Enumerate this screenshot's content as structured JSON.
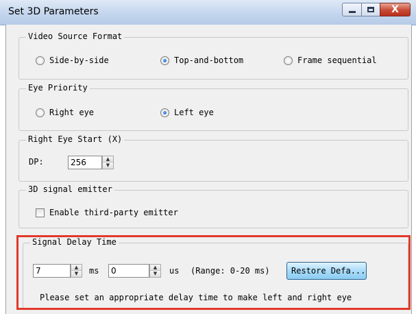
{
  "window": {
    "title": "Set 3D Parameters",
    "close_glyph": "X"
  },
  "video_source": {
    "title": "Video Source Format",
    "options": [
      {
        "label": "Side-by-side",
        "selected": false
      },
      {
        "label": "Top-and-bottom",
        "selected": true
      },
      {
        "label": "Frame sequential",
        "selected": false
      }
    ]
  },
  "eye_priority": {
    "title": "Eye Priority",
    "options": [
      {
        "label": "Right eye",
        "selected": false
      },
      {
        "label": "Left eye",
        "selected": true
      }
    ]
  },
  "right_eye_start": {
    "title": "Right Eye Start (X)",
    "dp_label": "DP:",
    "dp_value": "256"
  },
  "emitter": {
    "title": "3D signal emitter",
    "checkbox_label": "Enable third-party emitter",
    "checked": false
  },
  "signal_delay": {
    "title": "Signal Delay Time",
    "ms_value": "7",
    "ms_unit": "ms",
    "us_value": "0",
    "us_unit": "us",
    "range_text": "(Range: 0-20 ms)",
    "restore_label": "Restore Defa...",
    "hint": "Please set an appropriate delay time to make left and right eye"
  },
  "icons": {
    "spin_up": "▲",
    "spin_down": "▼"
  },
  "colors": {
    "highlight": "#e2382c",
    "close_button": "#c74a35",
    "restore_button": "#a9dcf8"
  }
}
